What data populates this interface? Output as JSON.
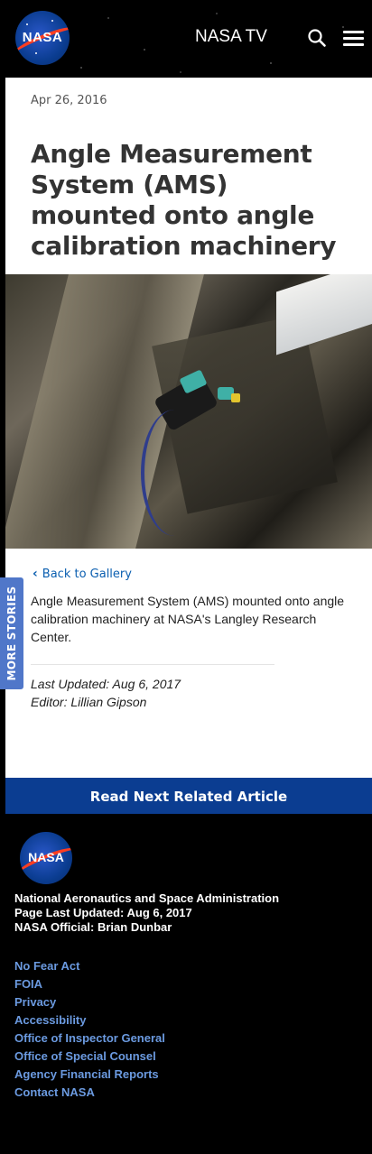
{
  "header": {
    "logo_text": "NASA",
    "tv_link": "NASA TV",
    "search_icon": "search-icon",
    "menu_icon": "hamburger-menu-icon"
  },
  "article": {
    "date": "Apr 26, 2016",
    "title": "Angle Measurement System (AMS) mounted onto angle calibration machinery",
    "back_link": "Back to Gallery",
    "caption": "Angle Measurement System (AMS) mounted onto angle calibration machinery at NASA's Langley Research Center.",
    "last_updated": "Last Updated: Aug 6, 2017",
    "editor": "Editor: Lillian Gipson"
  },
  "side_tab": {
    "label": "MORE STORIES"
  },
  "read_next": {
    "label": "Read Next Related Article"
  },
  "footer": {
    "logo_text": "NASA",
    "agency": "National Aeronautics and Space Administration",
    "page_updated": "Page Last Updated: Aug 6, 2017",
    "official": "NASA Official: Brian Dunbar",
    "links": [
      "No Fear Act",
      "FOIA",
      "Privacy",
      "Accessibility",
      "Office of Inspector General",
      "Office of Special Counsel",
      "Agency Financial Reports",
      "Contact NASA"
    ]
  },
  "colors": {
    "nasa_blue": "#0b3d91",
    "link_blue": "#0b5fb0",
    "footer_link": "#6b9ae0",
    "side_tab": "#5077c9",
    "nasa_red": "#fc3d21"
  }
}
